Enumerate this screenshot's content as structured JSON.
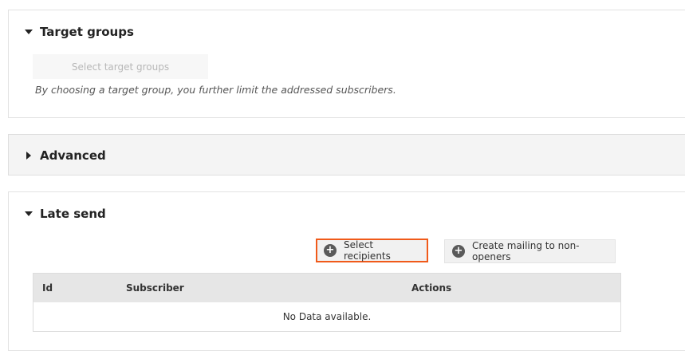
{
  "target_groups": {
    "title": "Target groups",
    "select_button": "Select target groups",
    "hint": "By choosing a target group, you further limit the addressed subscribers."
  },
  "advanced": {
    "title": "Advanced"
  },
  "late_send": {
    "title": "Late send",
    "buttons": {
      "select_recipients": "Select recipients",
      "create_mailing": "Create mailing to non-openers"
    },
    "table": {
      "columns": [
        "Id",
        "Subscriber",
        "Actions"
      ],
      "empty_text": "No Data available."
    }
  },
  "colors": {
    "highlight_border": "#f05a1a",
    "header_bg": "#e6e6e6"
  },
  "icons": {
    "expanded": "caret-down-icon",
    "collapsed": "caret-right-icon",
    "add": "plus-circle-icon"
  }
}
